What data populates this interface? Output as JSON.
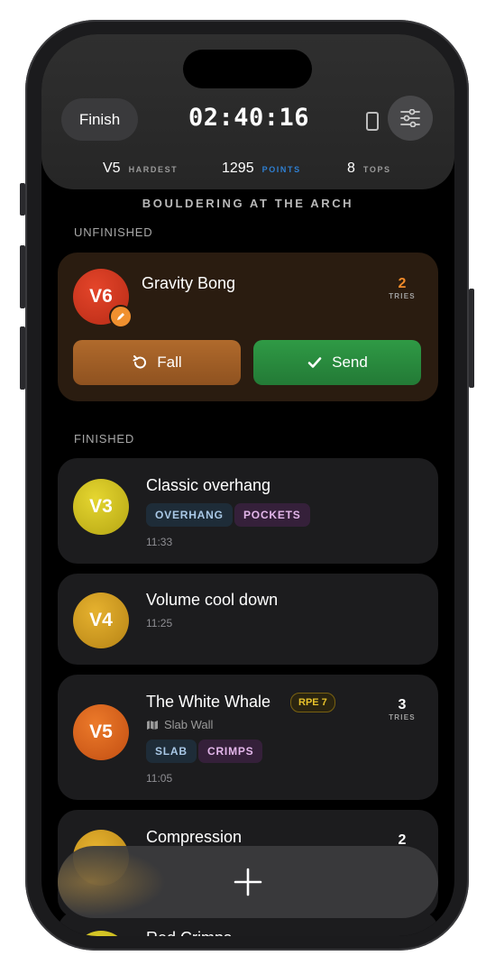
{
  "header": {
    "finish_label": "Finish",
    "timer": "02:40:16",
    "stats": [
      {
        "value": "V5",
        "label": "HARDEST"
      },
      {
        "value": "1295",
        "label": "POINTS"
      },
      {
        "value": "8",
        "label": "TOPS"
      }
    ]
  },
  "gym_title": "BOULDERING AT THE ARCH",
  "sections": {
    "unfinished": "UNFINISHED",
    "finished": "FINISHED"
  },
  "active_climb": {
    "grade": "V6",
    "name": "Gravity Bong",
    "tries": "2",
    "tries_label": "TRIES",
    "fall_label": "Fall",
    "send_label": "Send"
  },
  "climbs": [
    {
      "grade": "V3",
      "name": "Classic overhang",
      "tags": [
        "OVERHANG",
        "POCKETS"
      ],
      "time": "11:33"
    },
    {
      "grade": "V4",
      "name": "Volume cool down",
      "time": "11:25"
    },
    {
      "grade": "V5",
      "name": "The White Whale",
      "rpe": "RPE 7",
      "location": "Slab Wall",
      "tags": [
        "SLAB",
        "CRIMPS"
      ],
      "time": "11:05",
      "tries": "3",
      "tries_label": "TRIES"
    },
    {
      "grade": "",
      "name": "Compression",
      "tries": "2"
    },
    {
      "name": "Red Crimps"
    }
  ],
  "colors": {
    "v6": "#d13a1f",
    "v3": "#d6c51e",
    "v4": "#d9a520",
    "v5": "#e0661d",
    "points_label": "#2f7fd1",
    "tries_orange": "#f08a2a",
    "rpe": "#e7c22b"
  },
  "icons": {
    "settings": "sliders-icon",
    "device": "phone-icon",
    "fall": "retry-arrow-icon",
    "send": "checkmark-icon",
    "location": "map-icon",
    "add": "plus-icon",
    "badge": "pencil-badge-icon"
  }
}
